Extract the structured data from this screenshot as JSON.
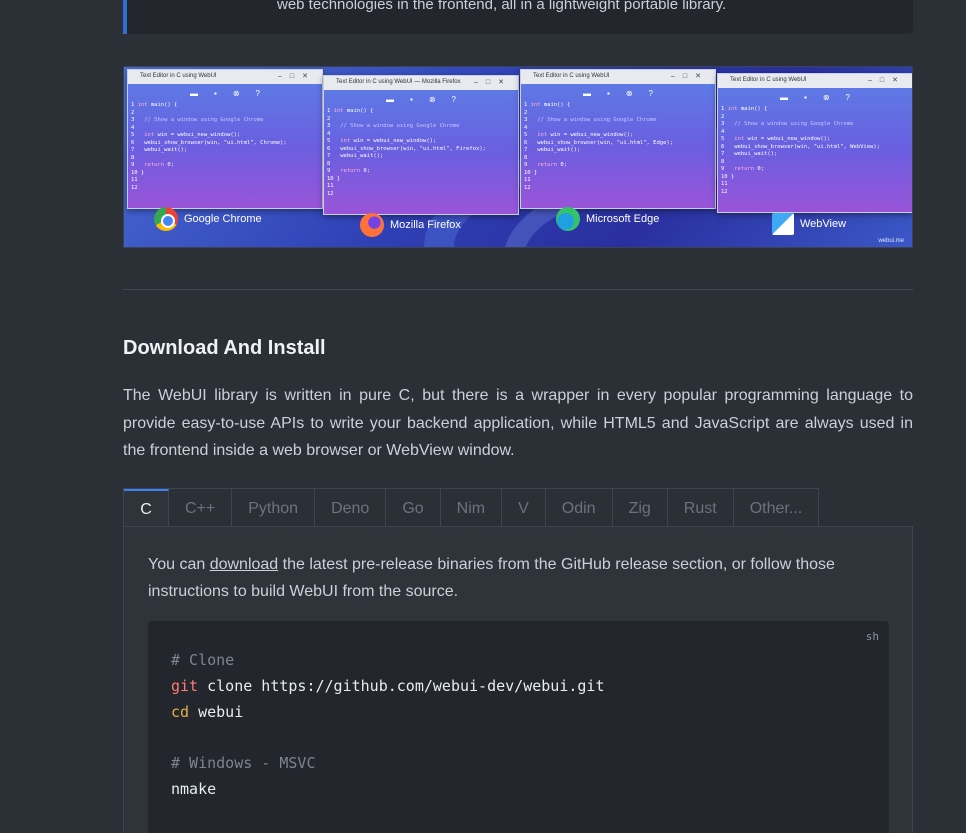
{
  "quote": {
    "text": "web technologies in the frontend, all in a lightweight portable library."
  },
  "hero": {
    "windows": [
      {
        "title": "Text Editor in C using WebUI",
        "browser": "Google Chrome",
        "logo": "chrome-logo-icon"
      },
      {
        "title": "Text Editor in C using WebUI — Mozilla Firefox",
        "browser": "Mozilla Firefox",
        "logo": "firefox-logo-icon"
      },
      {
        "title": "Text Editor in C using WebUI",
        "browser": "Microsoft Edge",
        "logo": "edge-logo-icon"
      },
      {
        "title": "Text Editor in C using WebUI",
        "browser": "WebView",
        "logo": "webview-logo-icon"
      }
    ],
    "code_lines": [
      "int main() {",
      "",
      "  // Show a window using Google Chrome",
      "",
      "  int win = webui_new_window();",
      "  webui_show_browser(win, \"ui.html\", Chrome);",
      "  webui_wait();",
      "",
      "  return 0;",
      "}",
      "",
      ""
    ],
    "watermark": "webui.me"
  },
  "section": {
    "heading": "Download And Install",
    "paragraph": "The WebUI library is written in pure C, but there is a wrapper in every popular programming language to provide easy-to-use APIs to write your backend application, while HTML5 and JavaScript are always used in the frontend inside a web browser or WebView window."
  },
  "tabs": [
    "C",
    "C++",
    "Python",
    "Deno",
    "Go",
    "Nim",
    "V",
    "Odin",
    "Zig",
    "Rust",
    "Other..."
  ],
  "active_tab": "C",
  "panel": {
    "text_before": "You can ",
    "link": "download",
    "text_after": " the latest pre-release binaries from the GitHub release section, or follow those instructions to build WebUI from the source."
  },
  "code": {
    "lang": "sh",
    "comment1": "# Clone",
    "git": "git",
    "git_args": " clone https://github.com/webui-dev/webui.git",
    "cd": "cd",
    "cd_args": " webui",
    "comment2": "# Windows - MSVC",
    "nmake": "nmake"
  },
  "colors": {
    "background": "#2b2f36",
    "accent": "#3b82f6",
    "code_bg": "#23262c"
  }
}
